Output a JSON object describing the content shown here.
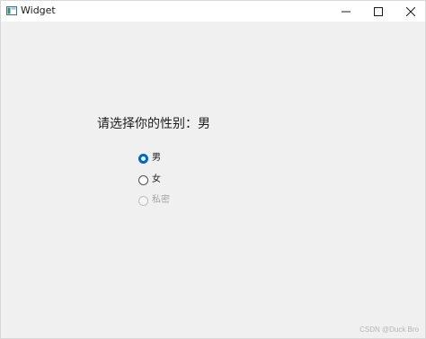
{
  "window": {
    "title": "Widget",
    "icon": "app-window-icon",
    "controls": [
      "minimize-icon",
      "maximize-icon",
      "close-icon"
    ]
  },
  "form": {
    "prompt": "请选择你的性别：男",
    "options": [
      {
        "label": "男",
        "checked": true,
        "enabled": true
      },
      {
        "label": "女",
        "checked": false,
        "enabled": true
      },
      {
        "label": "私密",
        "checked": false,
        "enabled": false
      }
    ]
  },
  "watermark": "CSDN @Duck Bro",
  "colors": {
    "accent": "#0067c0",
    "background": "#f0f0f0"
  }
}
